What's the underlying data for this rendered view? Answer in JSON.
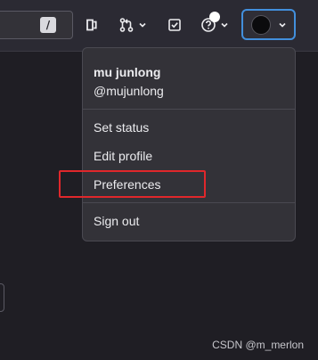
{
  "search": {
    "shortcut_key": "/"
  },
  "topbar": {
    "icons": {
      "issues": "issue-icon",
      "merge_requests": "merge-request-icon",
      "todos": "todo-checkbox-icon",
      "help": "help-circle-icon",
      "caret": "chevron-down-icon"
    }
  },
  "user_menu": {
    "name": "mu junlong",
    "handle": "@mujunlong",
    "items": [
      {
        "label": "Set status"
      },
      {
        "label": "Edit profile"
      },
      {
        "label": "Preferences"
      },
      {
        "label": "Sign out"
      }
    ]
  },
  "watermark": "CSDN @m_merlon",
  "colors": {
    "accent": "#428fdc",
    "highlight": "#e0272b",
    "menu_bg": "#333238",
    "page_bg": "#1f1e24"
  }
}
